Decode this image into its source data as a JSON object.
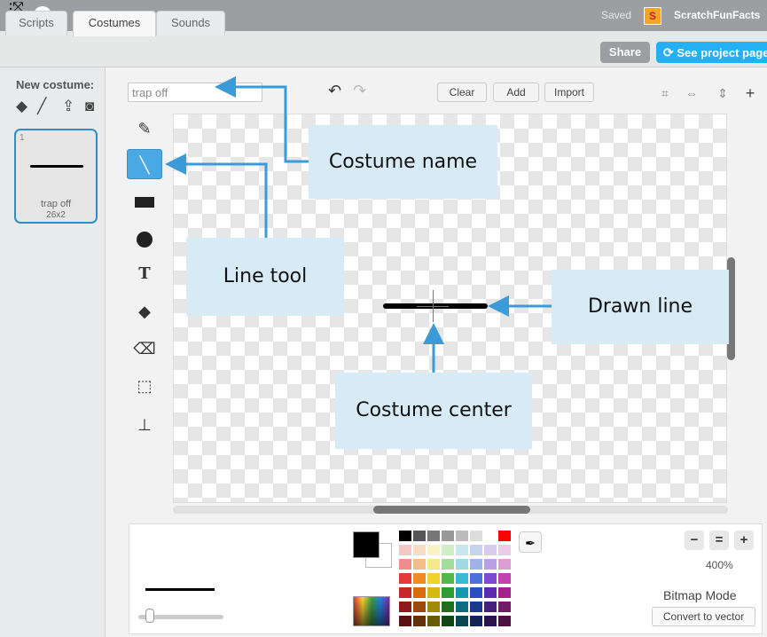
{
  "topbar": {
    "saved": "Saved",
    "user_logo": "S",
    "username": "ScratchFunFacts"
  },
  "tabs": [
    {
      "label": "Scripts"
    },
    {
      "label": "Costumes"
    },
    {
      "label": "Sounds"
    }
  ],
  "header_buttons": {
    "share": "Share",
    "see_project": "See project page"
  },
  "costume_pane": {
    "new_costume_label": "New costume:",
    "costume": {
      "index": "1",
      "name": "trap off",
      "size": "26x2"
    }
  },
  "editor": {
    "costume_name_value": "trap off",
    "buttons": {
      "clear": "Clear",
      "add": "Add",
      "import": "Import"
    },
    "zoom_level": "400%",
    "mode_label": "Bitmap Mode",
    "convert_button": "Convert to vector"
  },
  "colors": {
    "accent": "#25aff4",
    "selected_tool": "#4aa8e4",
    "callout_bg": "#d7ebf7",
    "arrow": "#3b9bd8",
    "foreground": "#000000",
    "background": "#ffffff",
    "palette_rows": [
      [
        "#000000",
        "#555555",
        "#777777",
        "#999999",
        "#bbbbbb",
        "#dddddd",
        "#ffffff",
        "#ff0000"
      ],
      [
        "#f4c6c6",
        "#f8ddc2",
        "#f8f3c2",
        "#cfeec8",
        "#c8e8ef",
        "#c8d3f0",
        "#d8cbef",
        "#eccbe6"
      ],
      [
        "#f08d8d",
        "#f4bc86",
        "#f5e98b",
        "#a3dd9b",
        "#9fd8e6",
        "#9fb2ea",
        "#b89fe6",
        "#dc9fd3"
      ],
      [
        "#e53935",
        "#f08a24",
        "#f2d22a",
        "#52b84a",
        "#3ab8d4",
        "#4a72d9",
        "#7e4ad1",
        "#c043b0"
      ],
      [
        "#c62828",
        "#d86a10",
        "#d8b80e",
        "#2e9c2e",
        "#1597b4",
        "#2a4fc0",
        "#5d2ab2",
        "#a0238f"
      ],
      [
        "#8e1b1b",
        "#9a4a0c",
        "#a08a0a",
        "#1f6e1f",
        "#0f6c80",
        "#1d378a",
        "#43207e",
        "#731a66"
      ],
      [
        "#5a1010",
        "#643008",
        "#685a06",
        "#134613",
        "#0a4652",
        "#122358",
        "#2a1450",
        "#4a1142"
      ]
    ]
  },
  "callouts": {
    "costume_name": "Costume name",
    "line_tool": "Line tool",
    "drawn_line": "Drawn line",
    "costume_center": "Costume center"
  }
}
